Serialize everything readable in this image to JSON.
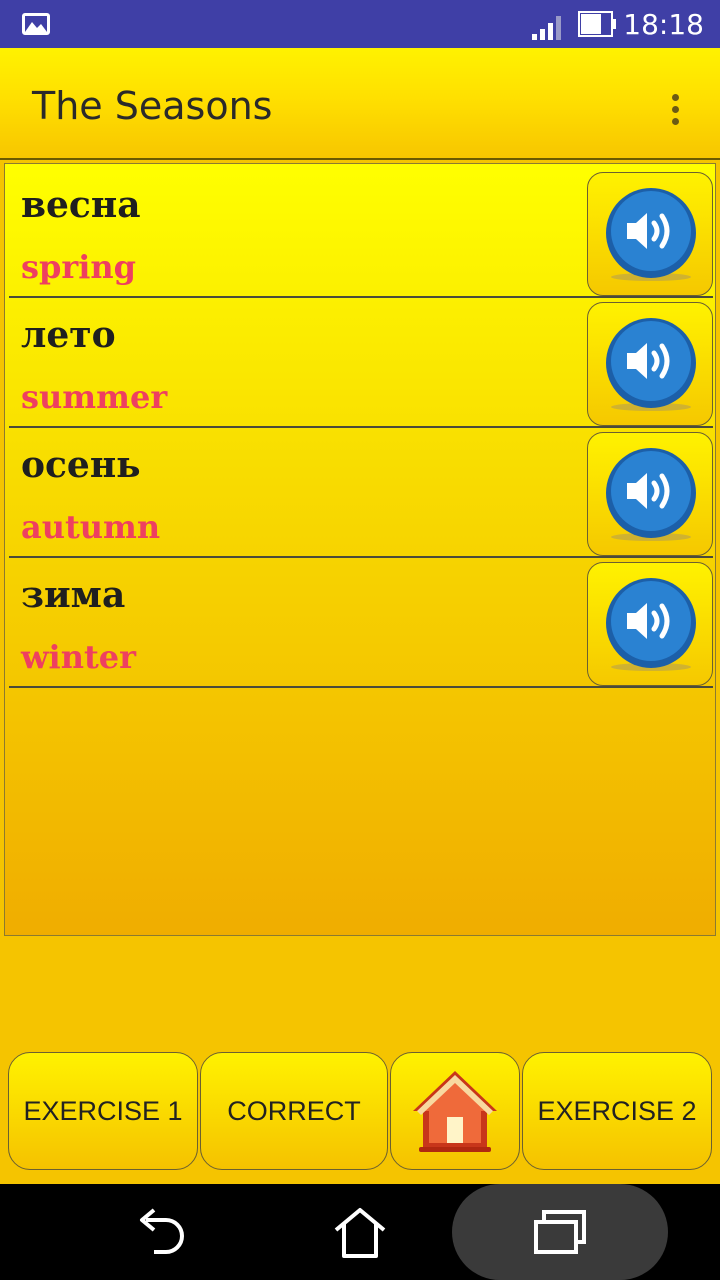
{
  "status_bar": {
    "time": "18:18",
    "icons": [
      "gallery-notification-icon",
      "signal-icon",
      "battery-icon"
    ]
  },
  "app_bar": {
    "title": "The Seasons",
    "menu_icon": "overflow-menu-icon"
  },
  "words": [
    {
      "ru": "весна",
      "en": "spring",
      "sound_icon": "speaker-icon"
    },
    {
      "ru": "лето",
      "en": "summer",
      "sound_icon": "speaker-icon"
    },
    {
      "ru": "осень",
      "en": "autumn",
      "sound_icon": "speaker-icon"
    },
    {
      "ru": "зима",
      "en": "winter",
      "sound_icon": "speaker-icon"
    }
  ],
  "bottom_buttons": {
    "exercise1": "EXERCISE 1",
    "correct": "CORRECT",
    "home_icon": "home-icon",
    "exercise2": "EXERCISE 2"
  },
  "nav_bar": {
    "icons": [
      "back-icon",
      "home-icon",
      "recents-icon"
    ]
  },
  "colors": {
    "status_bar": "#3f3fa6",
    "background": "#f5c400",
    "russian_text": "#1f1f1f",
    "english_text": "#ee3f60",
    "speaker_button": "#1e6fbf"
  }
}
